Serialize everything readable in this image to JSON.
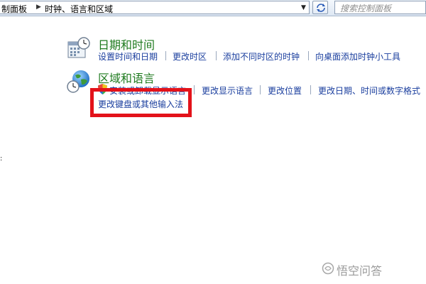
{
  "address_bar": {
    "crumbs": [
      "制面板",
      "时钟、语言和区域"
    ],
    "search_placeholder": "搜索控制面板"
  },
  "categories": [
    {
      "title": "日期和时间",
      "icon": "calendar-clock-icon",
      "links": [
        "设置时间和日期",
        "更改时区",
        "添加不同时区的时钟",
        "向桌面添加时钟小工具"
      ]
    },
    {
      "title": "区域和语言",
      "icon": "globe-clock-icon",
      "links": [
        "安装或卸载显示语言",
        "更改显示语言",
        "更改位置",
        "更改日期、时间或数字格式",
        "更改键盘或其他输入法"
      ]
    }
  ],
  "highlight_color": "#e3121a",
  "watermark": "悟空问答"
}
